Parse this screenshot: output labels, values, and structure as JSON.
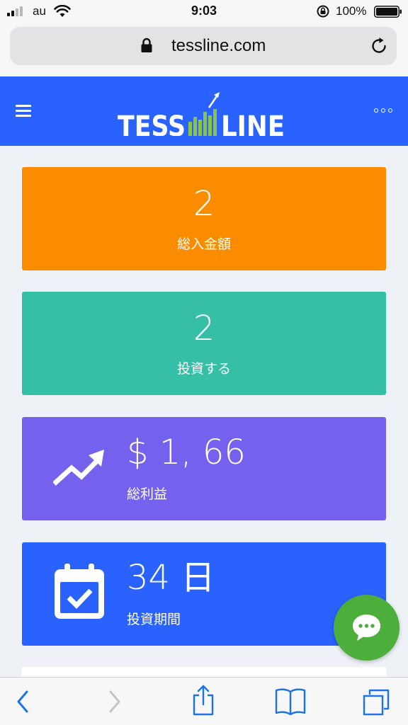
{
  "status_bar": {
    "carrier": "au",
    "time": "9:03",
    "battery_percent": "100%",
    "signal_bars": 2,
    "battery_level": 1.0
  },
  "browser": {
    "url": "tessline.com"
  },
  "site": {
    "brand_accent": "#2962ff",
    "logo_text": "TESSLINE"
  },
  "cards": {
    "deposit": {
      "value": "2",
      "label": "総入金額",
      "color": "#fb8c00"
    },
    "invest": {
      "value": "2",
      "label": "投資する",
      "color": "#35bfa6"
    },
    "profit": {
      "value": "$ 1, 66",
      "label": "総利益",
      "icon": "trend-up-icon",
      "color": "#7462ee"
    },
    "period": {
      "value": "34 日",
      "label": "投資期間",
      "icon": "calendar-check-icon",
      "color": "#2962ff"
    }
  },
  "chat": {
    "icon": "chat-bubble-icon",
    "color": "#4caf3c"
  },
  "toolbar": {
    "icons": [
      "back-icon",
      "forward-icon",
      "share-icon",
      "bookmarks-icon",
      "tabs-icon"
    ]
  }
}
